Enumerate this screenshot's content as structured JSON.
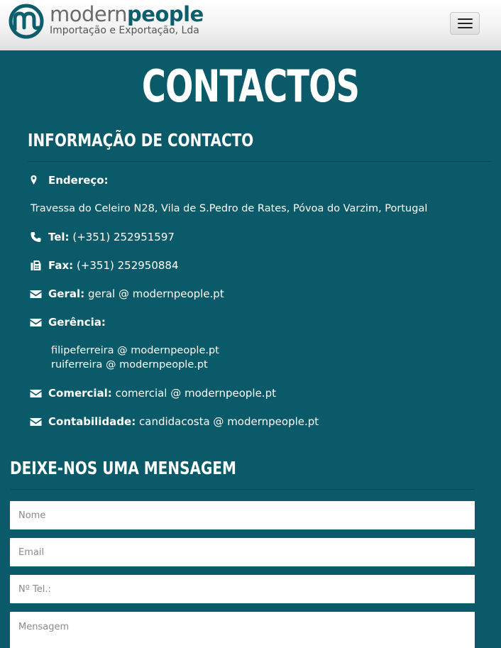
{
  "header": {
    "logo_name_a": "modern",
    "logo_name_b": "people",
    "logo_subtitle": "Importação e Exportação, Lda",
    "menu_button_label": "menu"
  },
  "page": {
    "title": "CONTACTOS"
  },
  "contact_info": {
    "heading": "INFORMAÇÃO DE CONTACTO",
    "address_label": "Endereço:",
    "address_value": "Travessa do Celeiro N28, Vila de S.Pedro de Rates, Póvoa do Varzim, Portugal",
    "tel_label": "Tel:",
    "tel_value": "(+351) 252951597",
    "fax_label": "Fax:",
    "fax_value": "(+351) 252950884",
    "geral_label": "Geral:",
    "geral_value": "geral @ modernpeople.pt",
    "gerencia_label": "Gerência:",
    "gerencia_emails": [
      "filipeferreira @ modernpeople.pt",
      "ruiferreira @ modernpeople.pt"
    ],
    "comercial_label": "Comercial:",
    "comercial_value": "comercial @ modernpeople.pt",
    "contabilidade_label": "Contabilidade:",
    "contabilidade_value": "candidacosta @ modernpeople.pt"
  },
  "contact_form": {
    "heading": "DEIXE-NOS UMA MENSAGEM",
    "name_placeholder": "Nome",
    "email_placeholder": "Email",
    "phone_placeholder": "Nº Tel.:",
    "message_placeholder": "Mensagem"
  },
  "colors": {
    "background": "#0b5a69",
    "brand": "#0d5e6d"
  },
  "icons": [
    "map-marker-icon",
    "phone-icon",
    "fax-icon",
    "envelope-icon"
  ]
}
